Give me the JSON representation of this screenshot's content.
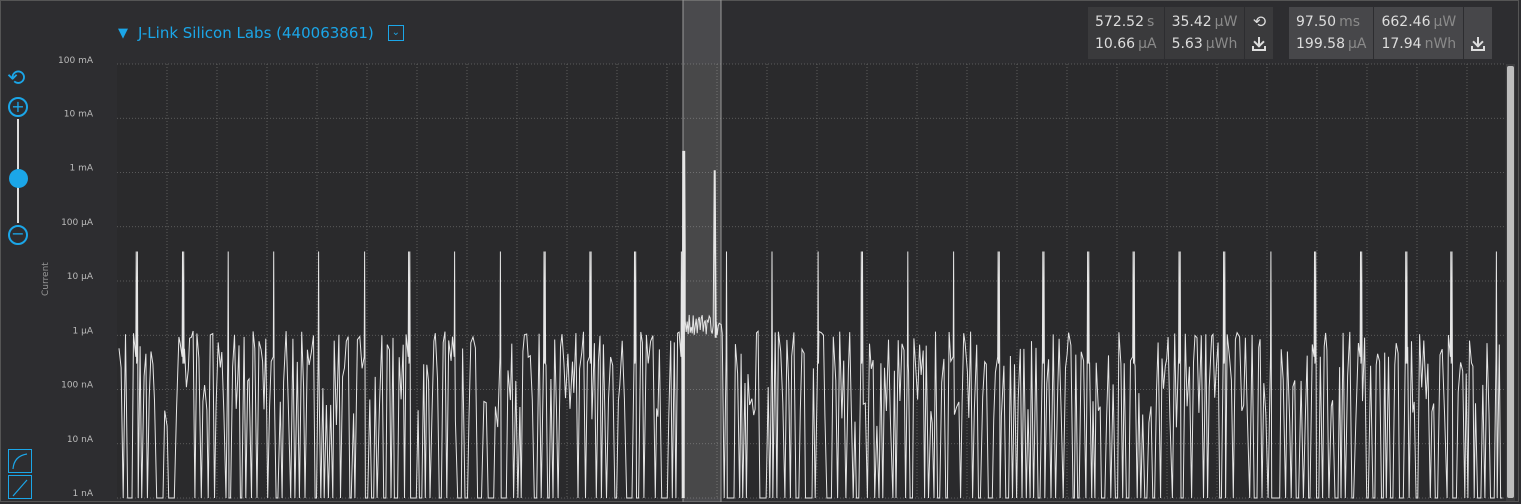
{
  "device": {
    "name": "J-Link Silicon Labs (440063861)",
    "collapse_icon": "triangle-down-icon",
    "dropdown_icon": "chevron-down-box-icon"
  },
  "window_stats": {
    "time_value": "572.52",
    "time_unit": "s",
    "avg_current_value": "10.66",
    "avg_current_unit": "µA",
    "avg_power_value": "35.42",
    "avg_power_unit": "µW",
    "energy_value": "5.63",
    "energy_unit": "µWh",
    "reset_icon": "reset-icon",
    "export_icon": "download-icon"
  },
  "selection_stats": {
    "time_value": "97.50",
    "time_unit": "ms",
    "avg_current_value": "199.58",
    "avg_current_unit": "µA",
    "avg_power_value": "662.46",
    "avg_power_unit": "µW",
    "energy_value": "17.94",
    "energy_unit": "nWh",
    "export_icon": "download-icon"
  },
  "zoom": {
    "reset_icon": "reset-zoom-icon",
    "in_icon": "plus-circle-icon",
    "out_icon": "minus-circle-icon",
    "level": 0.57
  },
  "y_axis_title": "Current",
  "colors": {
    "accent": "#1ba6e8",
    "trace": "#e6e6e6",
    "background": "#2d2d30",
    "plot": "#2a2a2c"
  },
  "chart_data": {
    "type": "line",
    "y_scale": "log",
    "y_tick_labels": [
      "100 mA",
      "10 mA",
      "1 mA",
      "100 µA",
      "10 µA",
      "1 µA",
      "100 nA",
      "10 nA",
      "1 nA"
    ],
    "ylim": [
      "1 nA",
      "100 mA"
    ],
    "grid": true,
    "series": [
      {
        "peaks": {
          "approx_count": 31,
          "level_uA": 35
        },
        "baseline_uA": [
          0.001,
          1.2
        ],
        "selection_peaks_mA": [
          2.5,
          1.1
        ]
      }
    ],
    "selection_range_fraction": [
      0.4,
      0.43
    ]
  }
}
